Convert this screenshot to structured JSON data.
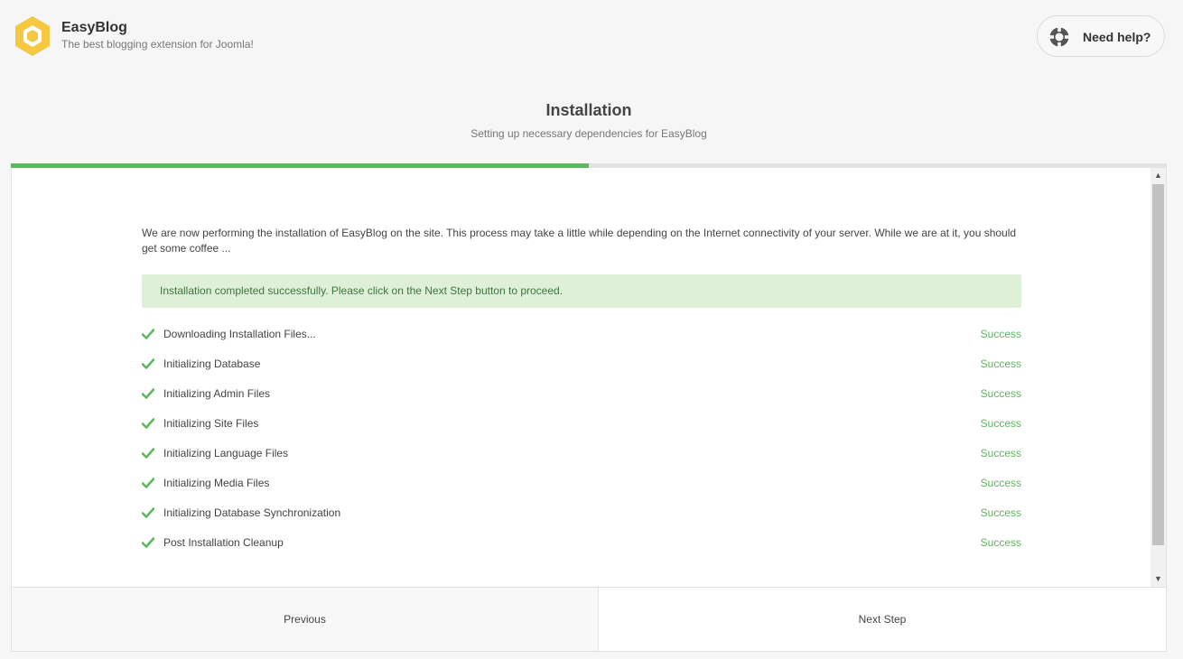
{
  "brand": {
    "name": "EasyBlog",
    "tagline": "The best blogging extension for Joomla!",
    "logo_icon": "hexagon-logo-icon",
    "logo_color": "#f5c842"
  },
  "help": {
    "label": "Need help?",
    "icon": "lifebuoy-icon"
  },
  "page": {
    "title": "Installation",
    "subtitle": "Setting up necessary dependencies for EasyBlog"
  },
  "progress": {
    "fraction": 0.5,
    "color": "#5cb85c"
  },
  "content": {
    "intro": "We are now performing the installation of EasyBlog on the site. This process may take a little while depending on the Internet connectivity of your server. While we are at it, you should get some coffee ...",
    "alert": "Installation completed successfully. Please click on the Next Step button to proceed.",
    "steps": [
      {
        "label": "Downloading Installation Files...",
        "status": "Success"
      },
      {
        "label": "Initializing Database",
        "status": "Success"
      },
      {
        "label": "Initializing Admin Files",
        "status": "Success"
      },
      {
        "label": "Initializing Site Files",
        "status": "Success"
      },
      {
        "label": "Initializing Language Files",
        "status": "Success"
      },
      {
        "label": "Initializing Media Files",
        "status": "Success"
      },
      {
        "label": "Initializing Database Synchronization",
        "status": "Success"
      },
      {
        "label": "Post Installation Cleanup",
        "status": "Success"
      }
    ],
    "step_icon": "check-icon",
    "success_color": "#5cb85c"
  },
  "footer": {
    "previous_label": "Previous",
    "next_label": "Next Step"
  }
}
